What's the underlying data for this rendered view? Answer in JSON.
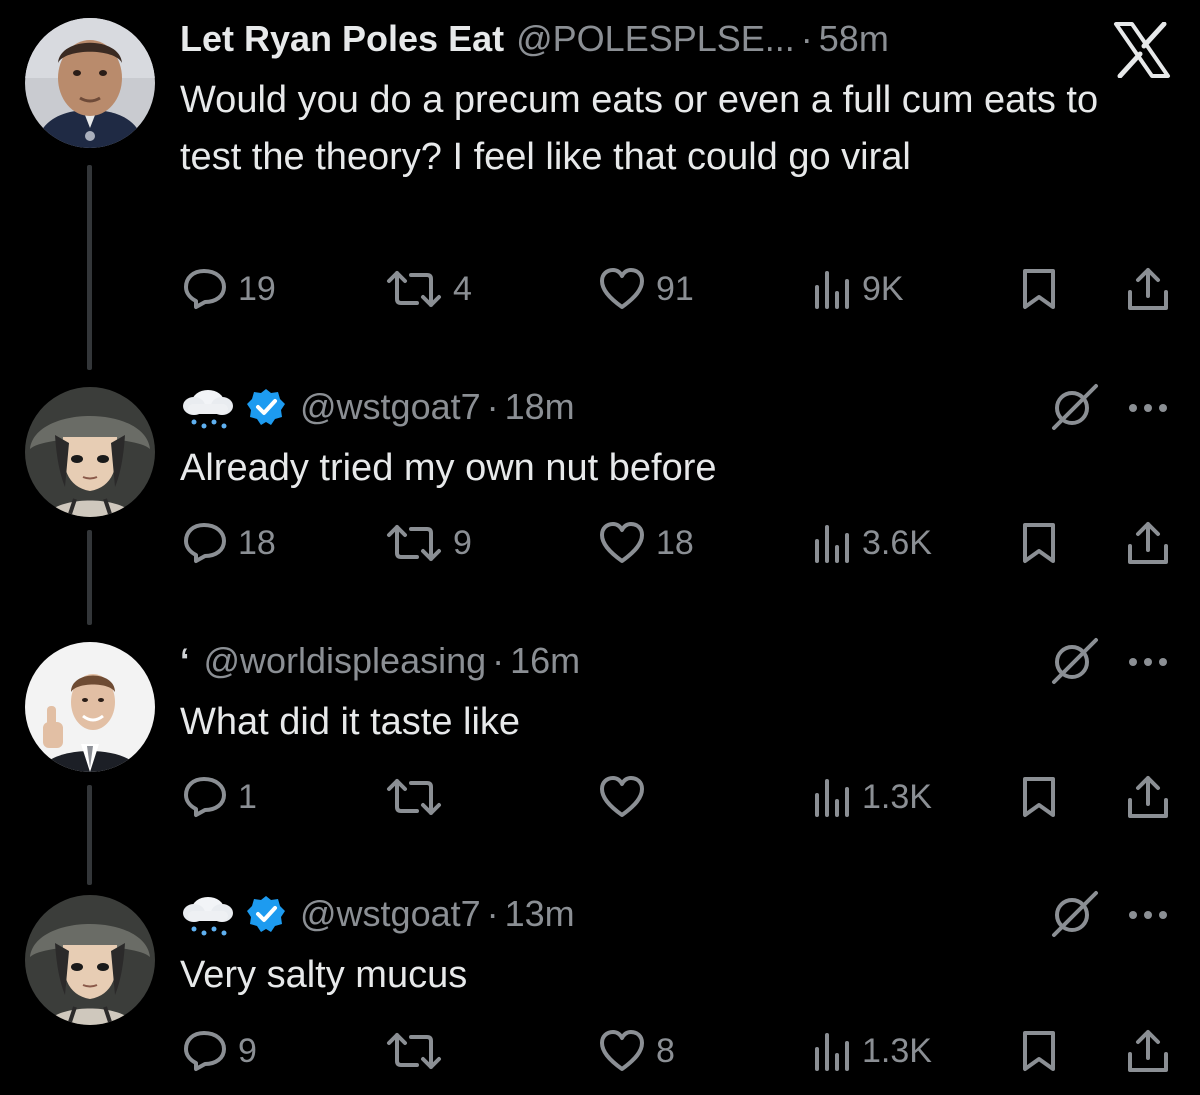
{
  "colors": {
    "background": "#000000",
    "text_primary": "#e7e9ea",
    "text_secondary": "#8b8f94",
    "verified_blue": "#1d9bf0",
    "thread_line": "#333639"
  },
  "app_logo": "x-logo",
  "tweets": [
    {
      "display_name": "Let Ryan Poles Eat",
      "handle": "@POLESPLSE...",
      "separator": "·",
      "time": "58m",
      "text": "Would you do a precum eats or even a full cum eats to test the theory? I feel like that could go viral",
      "replies": "19",
      "reposts": "4",
      "likes": "91",
      "views": "9K"
    },
    {
      "name_emoji": "cloud-with-rain",
      "verified": true,
      "handle": "@wstgoat7",
      "separator": "·",
      "time": "18m",
      "text": "Already tried my own nut before",
      "replies": "18",
      "reposts": "9",
      "likes": "18",
      "views": "3.6K"
    },
    {
      "name_prefix": "‘",
      "handle": "@worldispleasing",
      "separator": "·",
      "time": "16m",
      "text": "What did it taste like",
      "replies": "1",
      "reposts": "",
      "likes": "",
      "views": "1.3K"
    },
    {
      "name_emoji": "cloud-with-rain",
      "verified": true,
      "handle": "@wstgoat7",
      "separator": "·",
      "time": "13m",
      "text": "Very salty mucus",
      "replies": "9",
      "reposts": "",
      "likes": "8",
      "views": "1.3K"
    }
  ]
}
